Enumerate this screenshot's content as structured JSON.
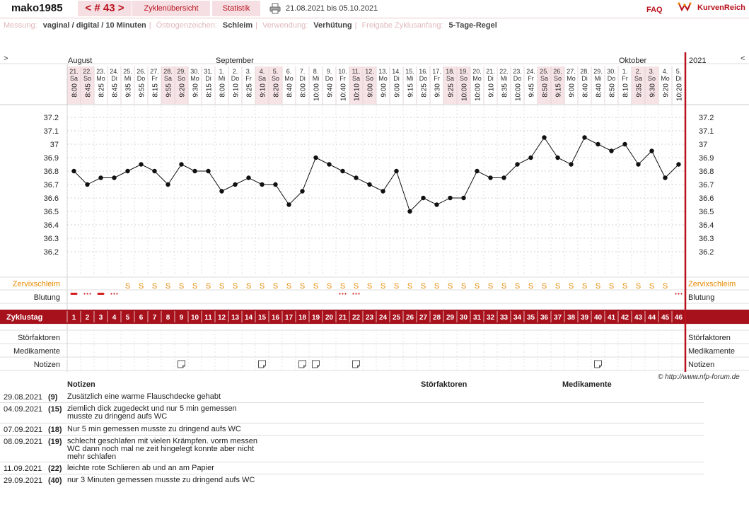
{
  "header": {
    "username": "mako1985",
    "cycle_nav": "< # 43 >",
    "tab_overview": "Zyklenübersicht",
    "tab_stats": "Statistik",
    "date_range": "21.08.2021 bis 05.10.2021",
    "faq": "FAQ",
    "brand": "KurvenReich"
  },
  "info": {
    "measurement_label": "Messung:",
    "measurement_value": "vaginal / digital / 10 Minuten",
    "estrogen_label": "Östrogenzeichen:",
    "estrogen_value": "Schleim",
    "usage_label": "Verwendung:",
    "usage_value": "Verhütung",
    "release_label": "Freigabe Zyklusanfang:",
    "release_value": "5-Tage-Regel"
  },
  "chart_data": {
    "type": "line",
    "year": "2021",
    "months": [
      {
        "label": "August",
        "start_index": 0
      },
      {
        "label": "September",
        "start_index": 11
      },
      {
        "label": "Oktober",
        "start_index": 41
      }
    ],
    "days": [
      "21.",
      "22.",
      "23.",
      "24.",
      "25.",
      "26.",
      "27.",
      "28.",
      "29.",
      "30.",
      "31.",
      "1.",
      "2.",
      "3.",
      "4.",
      "5.",
      "6.",
      "7.",
      "8.",
      "9.",
      "10.",
      "11.",
      "12.",
      "13.",
      "14.",
      "15.",
      "16.",
      "17.",
      "18.",
      "19.",
      "20.",
      "21.",
      "22.",
      "23.",
      "24.",
      "25.",
      "26.",
      "27.",
      "28.",
      "29.",
      "30.",
      "1.",
      "2.",
      "3.",
      "4.",
      "5."
    ],
    "weekdays": [
      "Sa",
      "So",
      "Mo",
      "Di",
      "Mi",
      "Do",
      "Fr",
      "Sa",
      "So",
      "Mo",
      "Di",
      "Mi",
      "Do",
      "Fr",
      "Sa",
      "So",
      "Mo",
      "Di",
      "Mi",
      "Do",
      "Fr",
      "Sa",
      "So",
      "Mo",
      "Di",
      "Mi",
      "Do",
      "Fr",
      "Sa",
      "So",
      "Mo",
      "Di",
      "Mi",
      "Do",
      "Fr",
      "Sa",
      "So",
      "Mo",
      "Di",
      "Mi",
      "Do",
      "Fr",
      "Sa",
      "So",
      "Mo",
      "Di"
    ],
    "times": [
      "8:00",
      "8:45",
      "8:25",
      "8:45",
      "9:35",
      "9:55",
      "8:15",
      "9:55",
      "9:20",
      "9:30",
      "8:15",
      "8:00",
      "9:10",
      "8:25",
      "9:10",
      "8:20",
      "8:40",
      "8:00",
      "10:00",
      "9:40",
      "10:40",
      "10:10",
      "9:00",
      "9:00",
      "9:00",
      "9:15",
      "8:25",
      "9:30",
      "9:25",
      "10:00",
      "10:00",
      "9:10",
      "8:35",
      "10:00",
      "9:45",
      "8:50",
      "9:15",
      "9:00",
      "8:40",
      "8:40",
      "8:50",
      "8:10",
      "9:35",
      "9:30",
      "9:20",
      "10:20"
    ],
    "cycle_days": [
      1,
      2,
      3,
      4,
      5,
      6,
      7,
      8,
      9,
      10,
      11,
      12,
      13,
      14,
      15,
      16,
      17,
      18,
      19,
      20,
      21,
      22,
      23,
      24,
      25,
      26,
      27,
      28,
      29,
      30,
      31,
      32,
      33,
      34,
      35,
      36,
      37,
      38,
      39,
      40,
      41,
      42,
      43,
      44,
      45,
      46
    ],
    "temperatures": [
      36.8,
      36.7,
      36.75,
      36.75,
      36.8,
      36.85,
      36.8,
      36.7,
      36.85,
      36.8,
      36.8,
      36.65,
      36.7,
      36.75,
      36.7,
      36.7,
      36.55,
      36.65,
      36.9,
      36.85,
      36.8,
      36.75,
      36.7,
      36.65,
      36.8,
      36.5,
      36.6,
      36.55,
      36.6,
      36.6,
      36.8,
      36.75,
      36.75,
      36.85,
      36.9,
      37.05,
      36.9,
      36.85,
      37.05,
      37.0,
      36.95,
      37.0,
      36.85,
      36.95,
      36.75,
      36.85
    ],
    "y_ticks": [
      "37.2",
      "37.1",
      "37",
      "36.9",
      "36.8",
      "36.7",
      "36.6",
      "36.5",
      "36.4",
      "36.3",
      "36.2"
    ],
    "ylim": [
      36.2,
      37.2
    ],
    "mucus": [
      "",
      "",
      "",
      "",
      "S",
      "S",
      "S",
      "S",
      "S",
      "S",
      "S",
      "S",
      "S",
      "S",
      "S",
      "S",
      "S",
      "S",
      "S",
      "S",
      "S",
      "S",
      "S",
      "S",
      "S",
      "S",
      "S",
      "S",
      "S",
      "S",
      "S",
      "S",
      "S",
      "S",
      "S",
      "S",
      "S",
      "S",
      "S",
      "S",
      "S",
      "S",
      "S",
      "S",
      "S",
      ""
    ],
    "bleeding": [
      "heavy",
      "light",
      "heavy",
      "light",
      "",
      "",
      "",
      "",
      "",
      "",
      "",
      "",
      "",
      "",
      "",
      "",
      "",
      "",
      "",
      "",
      "light",
      "light",
      "",
      "",
      "",
      "",
      "",
      "",
      "",
      "",
      "",
      "",
      "",
      "",
      "",
      "",
      "",
      "",
      "",
      "",
      "",
      "",
      "",
      "",
      "",
      "light"
    ],
    "notes_days": [
      9,
      15,
      18,
      19,
      22,
      40
    ],
    "row_labels": {
      "mucus": "Zervixschleim",
      "bleeding": "Blutung",
      "cycle_day": "Zyklustag",
      "disturbances": "Störfaktoren",
      "medication": "Medikamente",
      "notes": "Notizen"
    },
    "colors": {
      "accent": "#b8121d",
      "mucus": "#e88a00",
      "bleeding": "#d32020",
      "weekend": "#f6e3e6"
    }
  },
  "notes_table": {
    "headers": {
      "notes": "Notizen",
      "disturbances": "Störfaktoren",
      "medication": "Medikamente"
    },
    "copyright": "© http://www.nfp-forum.de",
    "rows": [
      {
        "date": "29.08.2021",
        "day": "(9)",
        "text": "Zusätzlich eine warme Flauschdecke gehabt"
      },
      {
        "date": "04.09.2021",
        "day": "(15)",
        "text": "ziemlich dick zugedeckt und nur 5 min gemessen musste zu dringend aufs WC"
      },
      {
        "date": "07.09.2021",
        "day": "(18)",
        "text": "Nur 5 min gemessen musste zu dringend aufs WC"
      },
      {
        "date": "08.09.2021",
        "day": "(19)",
        "text": "schlecht geschlafen mit vielen Krämpfen. vorm messen WC dann noch mal ne zeit hingelegt konnte aber nicht mehr schlafen"
      },
      {
        "date": "11.09.2021",
        "day": "(22)",
        "text": "leichte rote Schlieren ab und an am Papier"
      },
      {
        "date": "29.09.2021",
        "day": "(40)",
        "text": "nur 3 Minuten gemessen musste zu dringend aufs WC"
      }
    ]
  }
}
